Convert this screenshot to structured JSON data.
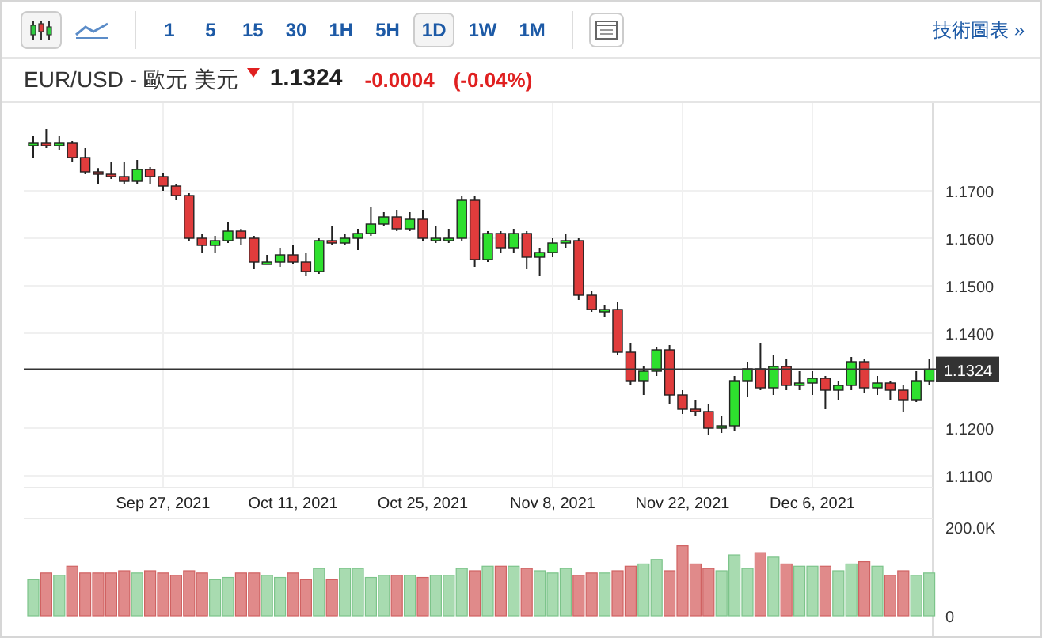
{
  "toolbar": {
    "chart_types": [
      {
        "kind": "candles",
        "selected": true
      },
      {
        "kind": "line",
        "selected": false
      }
    ],
    "intervals": [
      {
        "label": "1",
        "selected": false
      },
      {
        "label": "5",
        "selected": false
      },
      {
        "label": "15",
        "selected": false
      },
      {
        "label": "30",
        "selected": false
      },
      {
        "label": "1H",
        "selected": false
      },
      {
        "label": "5H",
        "selected": false
      },
      {
        "label": "1D",
        "selected": true
      },
      {
        "label": "1W",
        "selected": false
      },
      {
        "label": "1M",
        "selected": false
      }
    ],
    "link": "技術圖表 »"
  },
  "quote": {
    "symbol": "EUR/USD - 歐元 美元",
    "price_down": true,
    "price": "1.1324",
    "change": "-0.0004",
    "change_percent": "(-0.04%)"
  },
  "price_chart": {
    "chart_data": {
      "type": "candlestick",
      "ylim": [
        1.1075,
        1.1885
      ],
      "grid": true,
      "yticks": [
        {
          "value": 1.17,
          "label": "1.1700"
        },
        {
          "value": 1.16,
          "label": "1.1600"
        },
        {
          "value": 1.15,
          "label": "1.1500"
        },
        {
          "value": 1.14,
          "label": "1.1400"
        },
        {
          "value": 1.12,
          "label": "1.1200"
        },
        {
          "value": 1.11,
          "label": "1.1100"
        }
      ],
      "categories": [
        null,
        null,
        null,
        null,
        null,
        null,
        null,
        null,
        null,
        null,
        "Sep 27, 2021",
        null,
        null,
        null,
        null,
        null,
        null,
        null,
        null,
        null,
        "Oct 11, 2021",
        null,
        null,
        null,
        null,
        null,
        null,
        null,
        null,
        null,
        "Oct 25, 2021",
        null,
        null,
        null,
        null,
        null,
        null,
        null,
        null,
        null,
        "Nov 8, 2021",
        null,
        null,
        null,
        null,
        null,
        null,
        null,
        null,
        null,
        "Nov 22, 2021",
        null,
        null,
        null,
        null,
        null,
        null,
        null,
        null,
        null,
        "Dec 6, 2021",
        null,
        null,
        null,
        null,
        null,
        null,
        null,
        null,
        null
      ],
      "ref_lines": [
        {
          "axis": "y",
          "value": 1.1324,
          "label": "1.1324",
          "color": "#333333"
        }
      ],
      "ohlc": [
        [
          1.1795,
          1.1815,
          1.177,
          1.18
        ],
        [
          1.18,
          1.183,
          1.179,
          1.1795
        ],
        [
          1.1795,
          1.1815,
          1.1785,
          1.18
        ],
        [
          1.18,
          1.1805,
          1.176,
          1.177
        ],
        [
          1.177,
          1.179,
          1.1735,
          1.174
        ],
        [
          1.174,
          1.1748,
          1.1715,
          1.1735
        ],
        [
          1.1735,
          1.176,
          1.1725,
          1.173
        ],
        [
          1.173,
          1.176,
          1.1715,
          1.172
        ],
        [
          1.172,
          1.1765,
          1.1715,
          1.1745
        ],
        [
          1.1745,
          1.175,
          1.1715,
          1.173
        ],
        [
          1.173,
          1.1738,
          1.17,
          1.171
        ],
        [
          1.171,
          1.1715,
          1.168,
          1.169
        ],
        [
          1.169,
          1.1695,
          1.1595,
          1.16
        ],
        [
          1.16,
          1.161,
          1.157,
          1.1585
        ],
        [
          1.1585,
          1.1605,
          1.157,
          1.1595
        ],
        [
          1.1595,
          1.1635,
          1.159,
          1.1615
        ],
        [
          1.1615,
          1.162,
          1.1585,
          1.16
        ],
        [
          1.16,
          1.1605,
          1.1535,
          1.155
        ],
        [
          1.155,
          1.1565,
          1.1545,
          1.155
        ],
        [
          1.155,
          1.158,
          1.154,
          1.1565
        ],
        [
          1.1565,
          1.1585,
          1.1545,
          1.155
        ],
        [
          1.155,
          1.157,
          1.152,
          1.153
        ],
        [
          1.153,
          1.16,
          1.1525,
          1.1595
        ],
        [
          1.1595,
          1.1625,
          1.1585,
          1.159
        ],
        [
          1.159,
          1.161,
          1.1585,
          1.16
        ],
        [
          1.16,
          1.162,
          1.1575,
          1.161
        ],
        [
          1.161,
          1.1665,
          1.1605,
          1.163
        ],
        [
          1.163,
          1.1655,
          1.1625,
          1.1645
        ],
        [
          1.1645,
          1.166,
          1.1615,
          1.162
        ],
        [
          1.162,
          1.1655,
          1.1615,
          1.164
        ],
        [
          1.164,
          1.166,
          1.1595,
          1.16
        ],
        [
          1.16,
          1.1625,
          1.159,
          1.16
        ],
        [
          1.16,
          1.162,
          1.159,
          1.16
        ],
        [
          1.16,
          1.169,
          1.1595,
          1.168
        ],
        [
          1.168,
          1.169,
          1.154,
          1.1555
        ],
        [
          1.1555,
          1.1615,
          1.155,
          1.161
        ],
        [
          1.161,
          1.1615,
          1.157,
          1.158
        ],
        [
          1.158,
          1.162,
          1.157,
          1.161
        ],
        [
          1.161,
          1.1615,
          1.1535,
          1.156
        ],
        [
          1.156,
          1.158,
          1.152,
          1.157
        ],
        [
          1.157,
          1.16,
          1.156,
          1.159
        ],
        [
          1.159,
          1.161,
          1.158,
          1.1595
        ],
        [
          1.1595,
          1.16,
          1.147,
          1.148
        ],
        [
          1.148,
          1.149,
          1.1445,
          1.145
        ],
        [
          1.145,
          1.146,
          1.1435,
          1.145
        ],
        [
          1.145,
          1.1465,
          1.1355,
          1.136
        ],
        [
          1.136,
          1.138,
          1.129,
          1.13
        ],
        [
          1.13,
          1.133,
          1.127,
          1.132
        ],
        [
          1.132,
          1.137,
          1.131,
          1.1365
        ],
        [
          1.1365,
          1.1375,
          1.125,
          1.127
        ],
        [
          1.127,
          1.128,
          1.123,
          1.124
        ],
        [
          1.124,
          1.126,
          1.1225,
          1.1235
        ],
        [
          1.1235,
          1.125,
          1.1185,
          1.12
        ],
        [
          1.12,
          1.1225,
          1.119,
          1.1205
        ],
        [
          1.1205,
          1.131,
          1.1195,
          1.13
        ],
        [
          1.13,
          1.134,
          1.1265,
          1.1325
        ],
        [
          1.1325,
          1.138,
          1.128,
          1.1285
        ],
        [
          1.1285,
          1.1355,
          1.127,
          1.133
        ],
        [
          1.133,
          1.1345,
          1.128,
          1.129
        ],
        [
          1.129,
          1.132,
          1.128,
          1.1295
        ],
        [
          1.1295,
          1.132,
          1.127,
          1.1305
        ],
        [
          1.1305,
          1.131,
          1.124,
          1.128
        ],
        [
          1.128,
          1.13,
          1.126,
          1.129
        ],
        [
          1.129,
          1.135,
          1.128,
          1.134
        ],
        [
          1.134,
          1.1345,
          1.1275,
          1.1285
        ],
        [
          1.1285,
          1.131,
          1.127,
          1.1295
        ],
        [
          1.1295,
          1.13,
          1.126,
          1.128
        ],
        [
          1.128,
          1.129,
          1.1235,
          1.126
        ],
        [
          1.126,
          1.132,
          1.1255,
          1.13
        ],
        [
          1.13,
          1.1345,
          1.129,
          1.1324
        ]
      ]
    }
  },
  "volume_chart": {
    "chart_data": {
      "type": "bar",
      "ylim": [
        0,
        217500
      ],
      "yticks": [
        {
          "value": 0,
          "label": "0"
        },
        {
          "value": 200000,
          "label": "200.0K"
        }
      ],
      "values": [
        80000,
        95000,
        90000,
        110000,
        95000,
        95000,
        95000,
        100000,
        95000,
        100000,
        95000,
        90000,
        100000,
        95000,
        80000,
        85000,
        95000,
        95000,
        90000,
        85000,
        95000,
        80000,
        105000,
        80000,
        105000,
        105000,
        85000,
        90000,
        90000,
        90000,
        85000,
        90000,
        90000,
        105000,
        100000,
        110000,
        110000,
        110000,
        105000,
        100000,
        95000,
        105000,
        90000,
        95000,
        95000,
        100000,
        110000,
        115000,
        125000,
        100000,
        155000,
        115000,
        105000,
        100000,
        135000,
        105000,
        140000,
        130000,
        115000,
        110000,
        110000,
        110000,
        100000,
        115000,
        120000,
        110000,
        90000,
        100000,
        90000,
        95000
      ]
    }
  }
}
